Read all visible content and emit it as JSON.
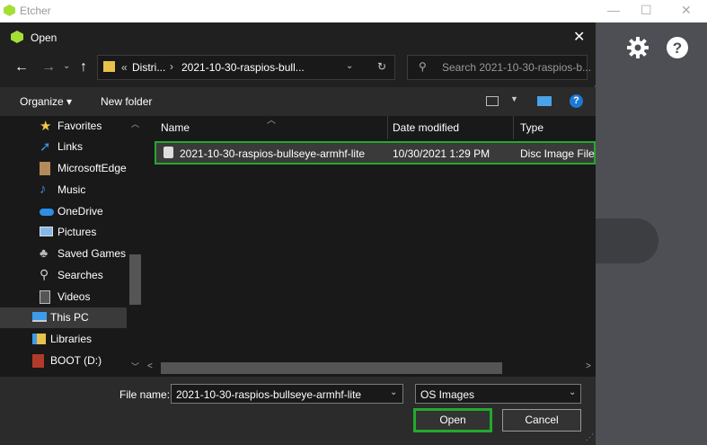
{
  "app": {
    "title": "Etcher"
  },
  "dialog": {
    "title": "Open",
    "address": {
      "overflow": "«",
      "crumbs": [
        "Distri...",
        "2021-10-30-raspios-bull..."
      ],
      "separator": "›"
    },
    "search": {
      "placeholder": "Search 2021-10-30-raspios-b..."
    },
    "toolbar": {
      "organize": "Organize ▾",
      "new_folder": "New folder"
    },
    "sidebar": {
      "items": [
        {
          "label": "Favorites",
          "icon": "star-icon"
        },
        {
          "label": "Links",
          "icon": "link-icon"
        },
        {
          "label": "MicrosoftEdge",
          "icon": "folder-icon"
        },
        {
          "label": "Music",
          "icon": "music-icon"
        },
        {
          "label": "OneDrive",
          "icon": "cloud-icon"
        },
        {
          "label": "Pictures",
          "icon": "pictures-icon"
        },
        {
          "label": "Saved Games",
          "icon": "games-icon"
        },
        {
          "label": "Searches",
          "icon": "search-icon"
        },
        {
          "label": "Videos",
          "icon": "videos-icon"
        },
        {
          "label": "This PC",
          "icon": "pc-icon"
        },
        {
          "label": "Libraries",
          "icon": "libraries-icon"
        },
        {
          "label": "BOOT (D:)",
          "icon": "drive-icon"
        }
      ]
    },
    "columns": [
      "Name",
      "Date modified",
      "Type"
    ],
    "files": [
      {
        "name": "2021-10-30-raspios-bullseye-armhf-lite",
        "date": "10/30/2021 1:29 PM",
        "type": "Disc Image File"
      }
    ],
    "filename_label": "File name:",
    "filename_value": "2021-10-30-raspios-bullseye-armhf-lite",
    "filetype_value": "OS Images",
    "open_label": "Open",
    "cancel_label": "Cancel",
    "highlight_color": "#23a92f"
  }
}
